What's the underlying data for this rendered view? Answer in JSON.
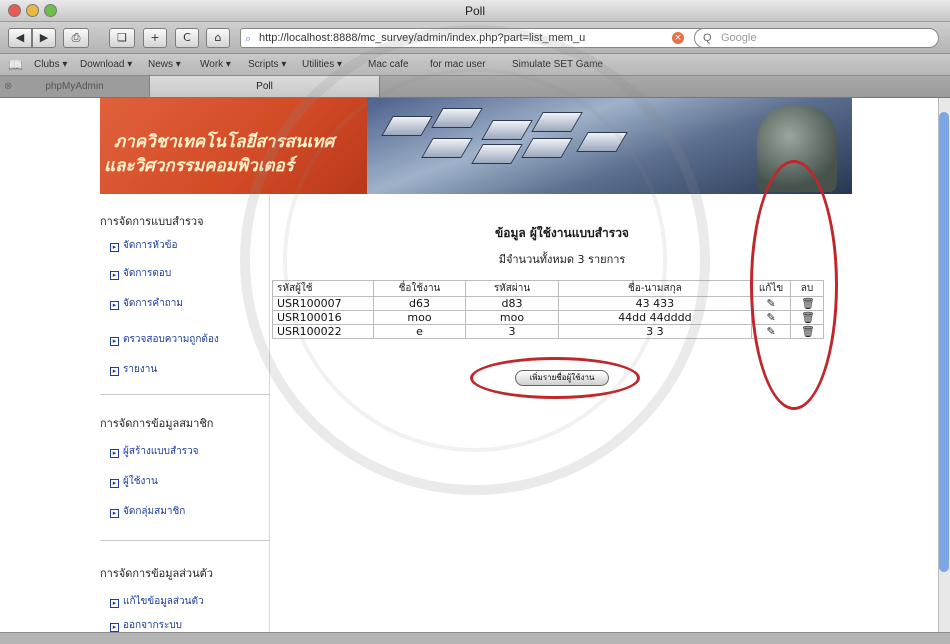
{
  "window": {
    "title": "Poll"
  },
  "toolbar": {
    "back_icon": "◀",
    "forward_icon": "▶",
    "print_icon": "⎙",
    "bookmark_icon": "❏",
    "add_icon": "+",
    "reload_icon": "C",
    "home_icon": "⌂",
    "address": "http://localhost:8888/mc_survey/admin/index.php?part=list_mem_u",
    "address_icon": "⌕",
    "stop_icon": "×",
    "search_placeholder": "Google",
    "search_icon": "Q"
  },
  "bookmarks": {
    "icon": "📖",
    "items": [
      "Clubs ▾",
      "Download ▾",
      "News ▾",
      "Work ▾",
      "Scripts ▾",
      "Utilities ▾",
      "Mac cafe",
      "for mac user",
      "Simulate SET Game"
    ]
  },
  "tabs": [
    {
      "label": "phpMyAdmin",
      "close": "⊗"
    },
    {
      "label": "Poll"
    }
  ],
  "banner": {
    "line1": "ภาควิชาเทคโนโลยีสารสนเทศ",
    "line2": "และวิศวกรรมคอมพิวเตอร์"
  },
  "sidebar": {
    "sections": [
      {
        "heading": "การจัดการแบบสำรวจ",
        "items": [
          "จัดการหัวข้อ",
          "จัดการตอบ",
          "จัดการคำถาม",
          "ตรวจสอบความถูกต้อง",
          "รายงาน"
        ]
      },
      {
        "heading": "การจัดการข้อมูลสมาชิก",
        "items": [
          "ผู้สร้างแบบสำรวจ",
          "ผู้ใช้งาน",
          "จัดกลุ่มสมาชิก"
        ]
      },
      {
        "heading": "การจัดการข้อมูลส่วนตัว",
        "items": [
          "แก้ไขข้อมูลส่วนตัว",
          "ออกจากระบบ"
        ]
      }
    ]
  },
  "content": {
    "title": "ข้อมูล ผู้ใช้งานแบบสำรวจ",
    "count_text": "มีจำนวนทั้งหมด 3 รายการ",
    "headers": {
      "id": "รหัสผู้ใช้",
      "username": "ชื่อใช้งาน",
      "password": "รหัสผ่าน",
      "fullname": "ชื่อ-นามสกุล",
      "edit": "แก้ไข",
      "delete": "ลบ"
    },
    "rows": [
      {
        "id": "USR100007",
        "username": "d63",
        "password": "d83",
        "fullname": "43  433"
      },
      {
        "id": "USR100016",
        "username": "moo",
        "password": "moo",
        "fullname": "44dd  44dddd"
      },
      {
        "id": "USR100022",
        "username": "e",
        "password": "3",
        "fullname": "3  3"
      }
    ],
    "edit_icon": "✎",
    "delete_icon": "🗑",
    "add_button": "เพิ่มรายชื่อผู้ใช้งาน"
  },
  "colors": {
    "annotation": "#c0262a",
    "banner_left": "#d14a25",
    "link": "#1a3d9c"
  }
}
